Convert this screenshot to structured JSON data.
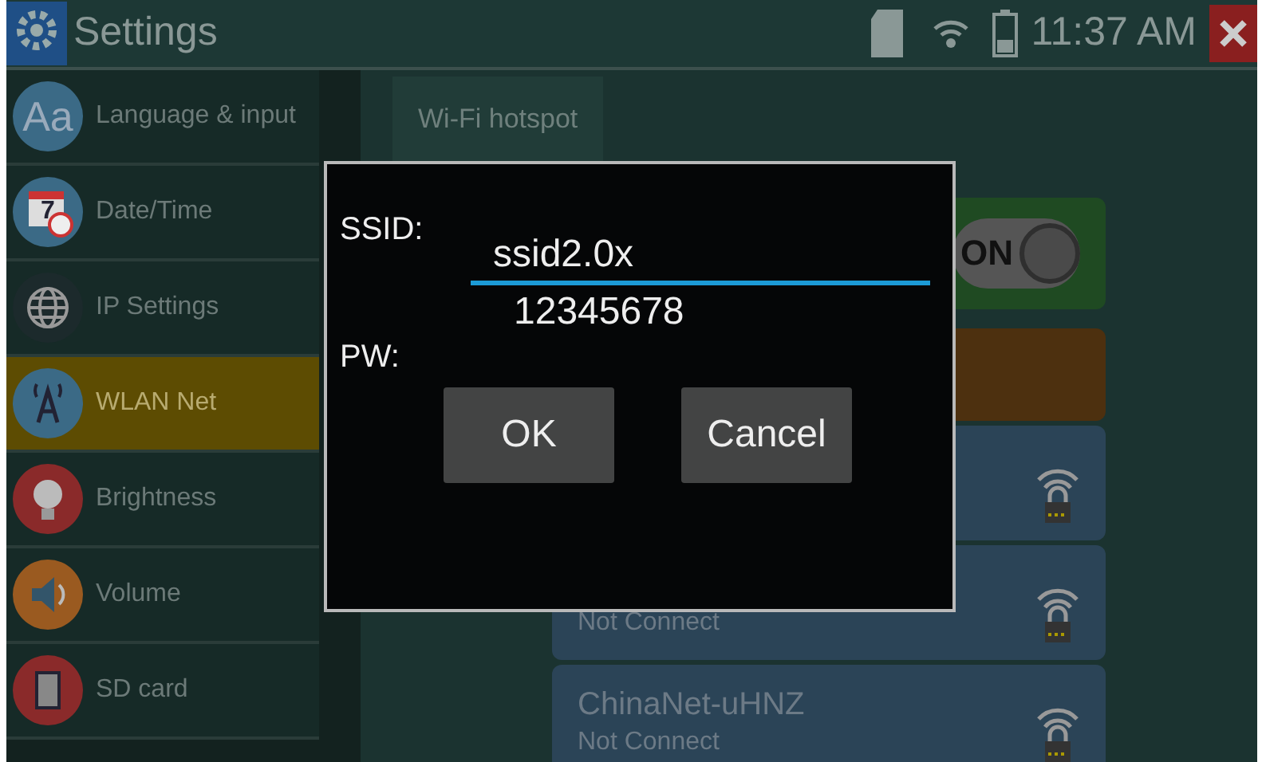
{
  "title_bar": {
    "title": "Settings",
    "time": "11:37 AM"
  },
  "sidebar": {
    "items": [
      {
        "kind": "language",
        "icon_text": "Aa",
        "label": "Language & input",
        "selected": false
      },
      {
        "kind": "datetime",
        "icon_text": "7",
        "label": "Date/Time",
        "selected": false
      },
      {
        "kind": "ip",
        "label": "IP Settings",
        "selected": false
      },
      {
        "kind": "wlan",
        "label": "WLAN Net",
        "selected": true
      },
      {
        "kind": "brightness",
        "label": "Brightness",
        "selected": false
      },
      {
        "kind": "volume",
        "label": "Volume",
        "selected": false
      },
      {
        "kind": "sdcard",
        "label": "SD card",
        "selected": false
      }
    ]
  },
  "tabs": [
    {
      "label": "Wi-Fi hotspot",
      "selected": false
    }
  ],
  "wifi_toggle": {
    "label": "ON",
    "on": true
  },
  "networks": [
    {
      "locked": true
    },
    {
      "status": "Not Connect",
      "locked": true
    },
    {
      "name": "ChinaNet-uHNZ",
      "status": "Not Connect",
      "locked": true
    }
  ],
  "dialog": {
    "ssid_label": "SSID:",
    "ssid_value": "ssid2.0x",
    "pw_label": "PW:",
    "pw_value": "12345678",
    "buttons": [
      "OK",
      "Cancel"
    ]
  }
}
